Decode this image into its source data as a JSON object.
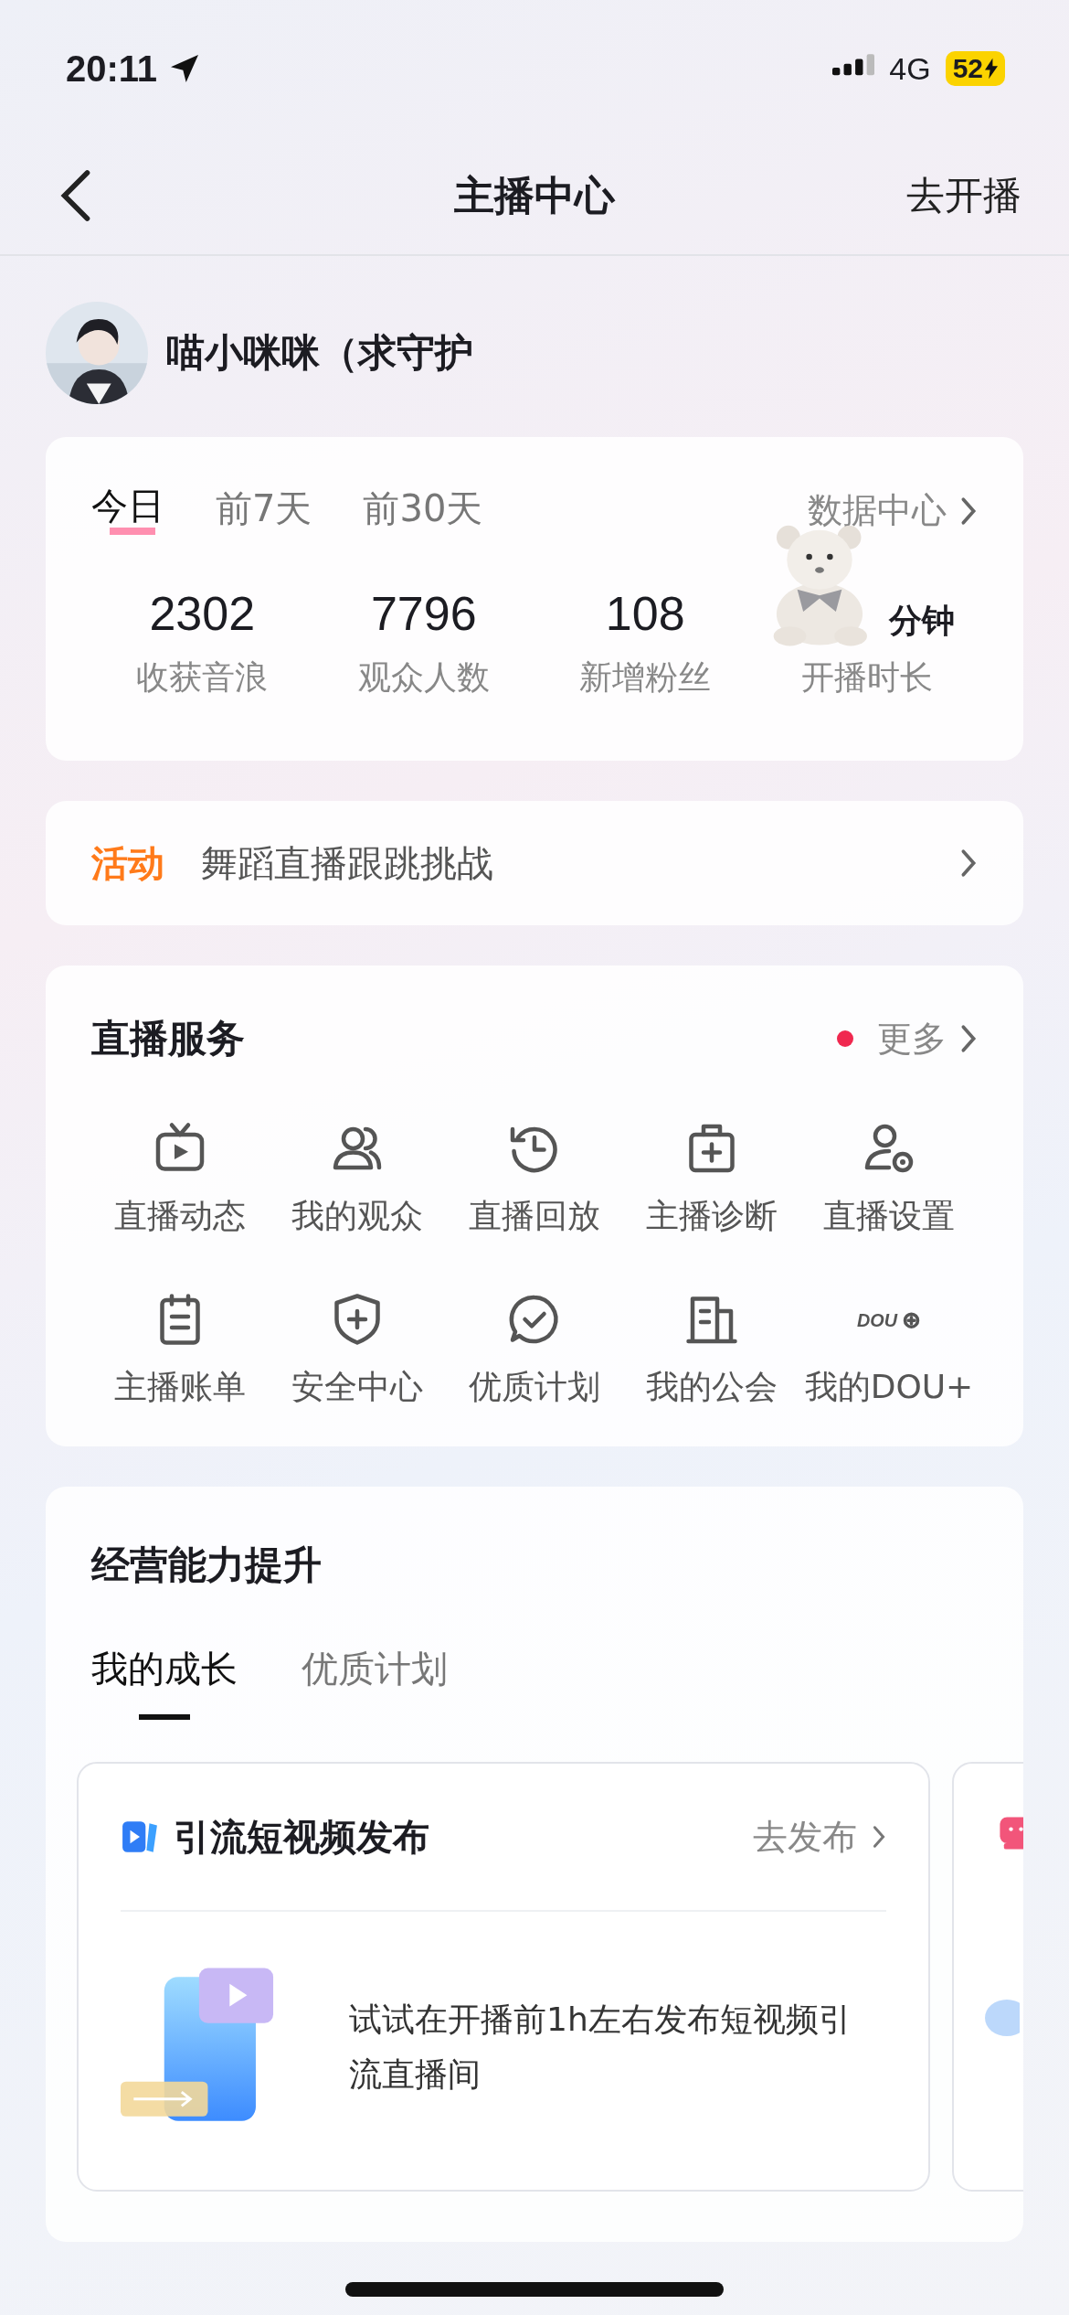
{
  "status_bar": {
    "time": "20:11",
    "network": "4G",
    "battery": "52"
  },
  "nav": {
    "title": "主播中心",
    "action": "去开播"
  },
  "profile": {
    "name": "喵小咪咪（求守护"
  },
  "stats": {
    "periods": [
      {
        "label": "今日",
        "selected": true
      },
      {
        "label": "前7天",
        "selected": false
      },
      {
        "label": "前30天",
        "selected": false
      }
    ],
    "link": "数据中心",
    "items": [
      {
        "value": "2302",
        "label": "收获音浪"
      },
      {
        "value": "7796",
        "label": "观众人数"
      },
      {
        "value": "108",
        "label": "新增粉丝"
      },
      {
        "value": "分钟",
        "label": "开播时长"
      }
    ]
  },
  "activity": {
    "tag": "活动",
    "text": "舞蹈直播跟跳挑战"
  },
  "services": {
    "title": "直播服务",
    "more": "更多",
    "new_dot": true,
    "items": [
      {
        "kind": "tv",
        "label": "直播动态"
      },
      {
        "kind": "users",
        "label": "我的观众"
      },
      {
        "kind": "replay",
        "label": "直播回放"
      },
      {
        "kind": "medkit",
        "label": "主播诊断"
      },
      {
        "kind": "user-gear",
        "label": "直播设置"
      },
      {
        "kind": "bill",
        "label": "主播账单"
      },
      {
        "kind": "shield",
        "label": "安全中心"
      },
      {
        "kind": "check",
        "label": "优质计划"
      },
      {
        "kind": "building",
        "label": "我的公会"
      },
      {
        "kind": "dou",
        "label": "我的DOU+",
        "icon_text": "DOU"
      }
    ]
  },
  "growth": {
    "title": "经营能力提升",
    "tabs": [
      {
        "label": "我的成长",
        "selected": true
      },
      {
        "label": "优质计划",
        "selected": false
      }
    ],
    "cards": [
      {
        "title": "引流短视频发布",
        "action": "去发布",
        "text": "试试在开播前1h左右发布短视频引流直播间"
      }
    ]
  }
}
